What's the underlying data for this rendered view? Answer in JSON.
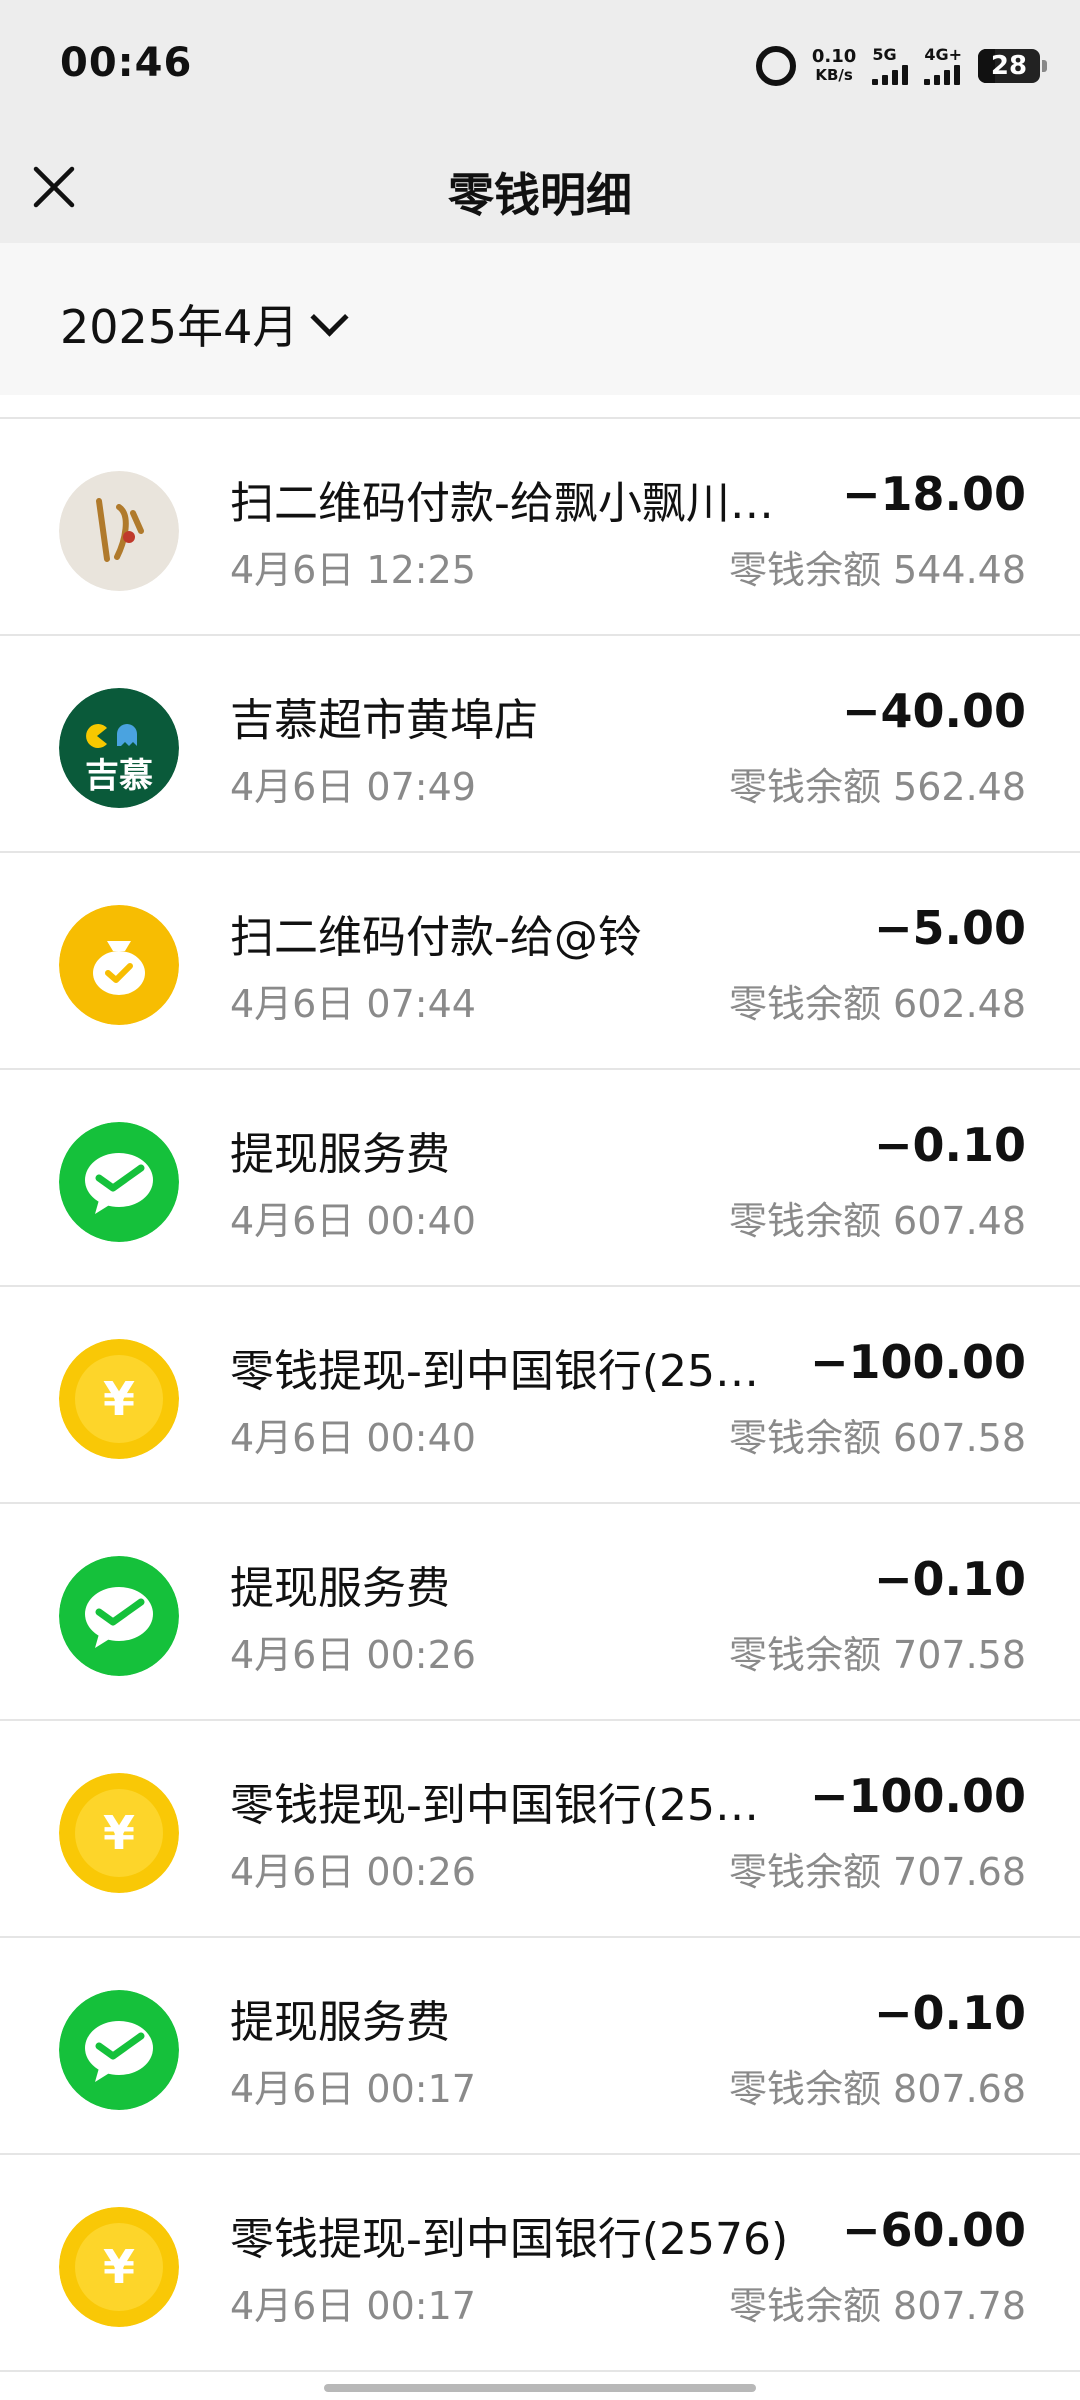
{
  "status_bar": {
    "time": "00:46",
    "net_speed_value": "0.10",
    "net_speed_unit": "KB/s",
    "signal1_label": "5G",
    "signal2_label": "4G+",
    "battery": "28"
  },
  "header": {
    "title": "零钱明细"
  },
  "filter": {
    "month": "2025年4月"
  },
  "transactions": [
    {
      "name": "扫二维码付款-给飘小飘川…",
      "date": "4月6日 12:25",
      "amount": "−18.00",
      "balance": "零钱余额 544.48",
      "icon": "merchant-photo"
    },
    {
      "name": "吉慕超市黄埠店",
      "date": "4月6日 07:49",
      "amount": "−40.00",
      "balance": "零钱余额 562.48",
      "icon": "jimu-logo",
      "icon_text": "吉慕"
    },
    {
      "name": "扫二维码付款-给@铃",
      "date": "4月6日 07:44",
      "amount": "−5.00",
      "balance": "零钱余额 602.48",
      "icon": "money-bag"
    },
    {
      "name": "提现服务费",
      "date": "4月6日 00:40",
      "amount": "−0.10",
      "balance": "零钱余额 607.48",
      "icon": "wechat-pay"
    },
    {
      "name": "零钱提现-到中国银行(25…",
      "date": "4月6日 00:40",
      "amount": "−100.00",
      "balance": "零钱余额 607.58",
      "icon": "yuan-coin"
    },
    {
      "name": "提现服务费",
      "date": "4月6日 00:26",
      "amount": "−0.10",
      "balance": "零钱余额 707.58",
      "icon": "wechat-pay"
    },
    {
      "name": "零钱提现-到中国银行(25…",
      "date": "4月6日 00:26",
      "amount": "−100.00",
      "balance": "零钱余额 707.68",
      "icon": "yuan-coin"
    },
    {
      "name": "提现服务费",
      "date": "4月6日 00:17",
      "amount": "−0.10",
      "balance": "零钱余额 807.68",
      "icon": "wechat-pay"
    },
    {
      "name": "零钱提现-到中国银行(2576)",
      "date": "4月6日 00:17",
      "amount": "−60.00",
      "balance": "零钱余额 807.78",
      "icon": "yuan-coin"
    }
  ],
  "colors": {
    "wechat_green": "#15c13b",
    "coin_yellow": "#f9c806",
    "jimu_green": "#0a5a3a",
    "header_bg": "#ededed"
  }
}
